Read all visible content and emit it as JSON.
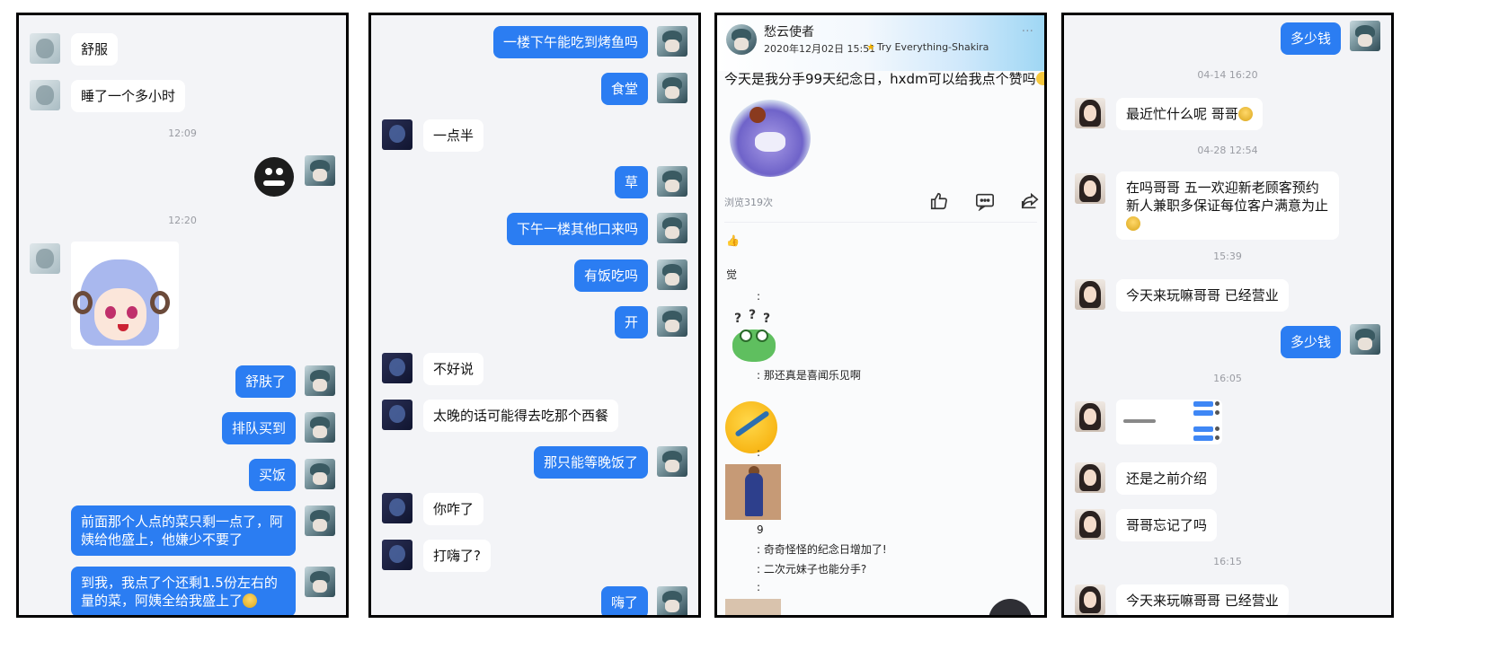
{
  "panel1": {
    "messages": [
      {
        "text": "舒服"
      },
      {
        "text": "睡了一个多小时"
      },
      {
        "text": "舒肤了"
      },
      {
        "text": "排队买到"
      },
      {
        "text": "买饭"
      },
      {
        "text": "前面那个人点的菜只剩一点了，阿姨给他盛上，他嫌少不要了"
      },
      {
        "text": "到我，我点了个还剩1.5份左右的量的菜，阿姨全给我盛上了"
      }
    ],
    "times": [
      "12:09",
      "12:20"
    ]
  },
  "panel2": {
    "messages": [
      {
        "text": "一楼下午能吃到烤鱼吗"
      },
      {
        "text": "食堂"
      },
      {
        "text": "一点半"
      },
      {
        "text": "草"
      },
      {
        "text": "下午一楼其他口来吗"
      },
      {
        "text": "有饭吃吗"
      },
      {
        "text": "开"
      },
      {
        "text": "不好说"
      },
      {
        "text": "太晚的话可能得去吃那个西餐"
      },
      {
        "text": "那只能等晚饭了"
      },
      {
        "text": "你咋了"
      },
      {
        "text": "打嗨了?"
      },
      {
        "text": "嗨了"
      }
    ]
  },
  "panel3": {
    "author": "愁云使者",
    "date": "2020年12月02日 15:51",
    "song": "Try Everything-Shakira",
    "more": "···",
    "post_text": "今天是我分手99天纪念日，hxdm可以给我点个赞吗",
    "views": "浏览319次",
    "likes_label": "觉",
    "comments": [
      ":",
      ": 那还真是喜闻乐见啊",
      ":",
      "9",
      ": 奇奇怪怪的纪念日增加了!",
      ": 二次元妹子也能分手?",
      ":"
    ],
    "icons": [
      "thumb-up-icon",
      "comment-icon",
      "share-icon"
    ]
  },
  "panel4": {
    "messages": [
      {
        "text": "多少钱"
      },
      {
        "text": "最近忙什么呢 哥哥"
      },
      {
        "text": "在吗哥哥 五一欢迎新老顾客预约新人兼职多保证每位客户满意为止"
      },
      {
        "text": "今天来玩嘛哥哥 已经营业"
      },
      {
        "text": "多少钱"
      },
      {
        "text": "还是之前介绍"
      },
      {
        "text": "哥哥忘记了吗"
      },
      {
        "text": "今天来玩嘛哥哥 已经营业"
      }
    ],
    "times": [
      "04-14 16:20",
      "04-28 12:54",
      "15:39",
      "16:05",
      "16:15"
    ]
  },
  "colors": {
    "outgoing_bubble": "#2b7df2",
    "incoming_bubble": "#ffffff",
    "chat_background": "#f3f4f7"
  }
}
